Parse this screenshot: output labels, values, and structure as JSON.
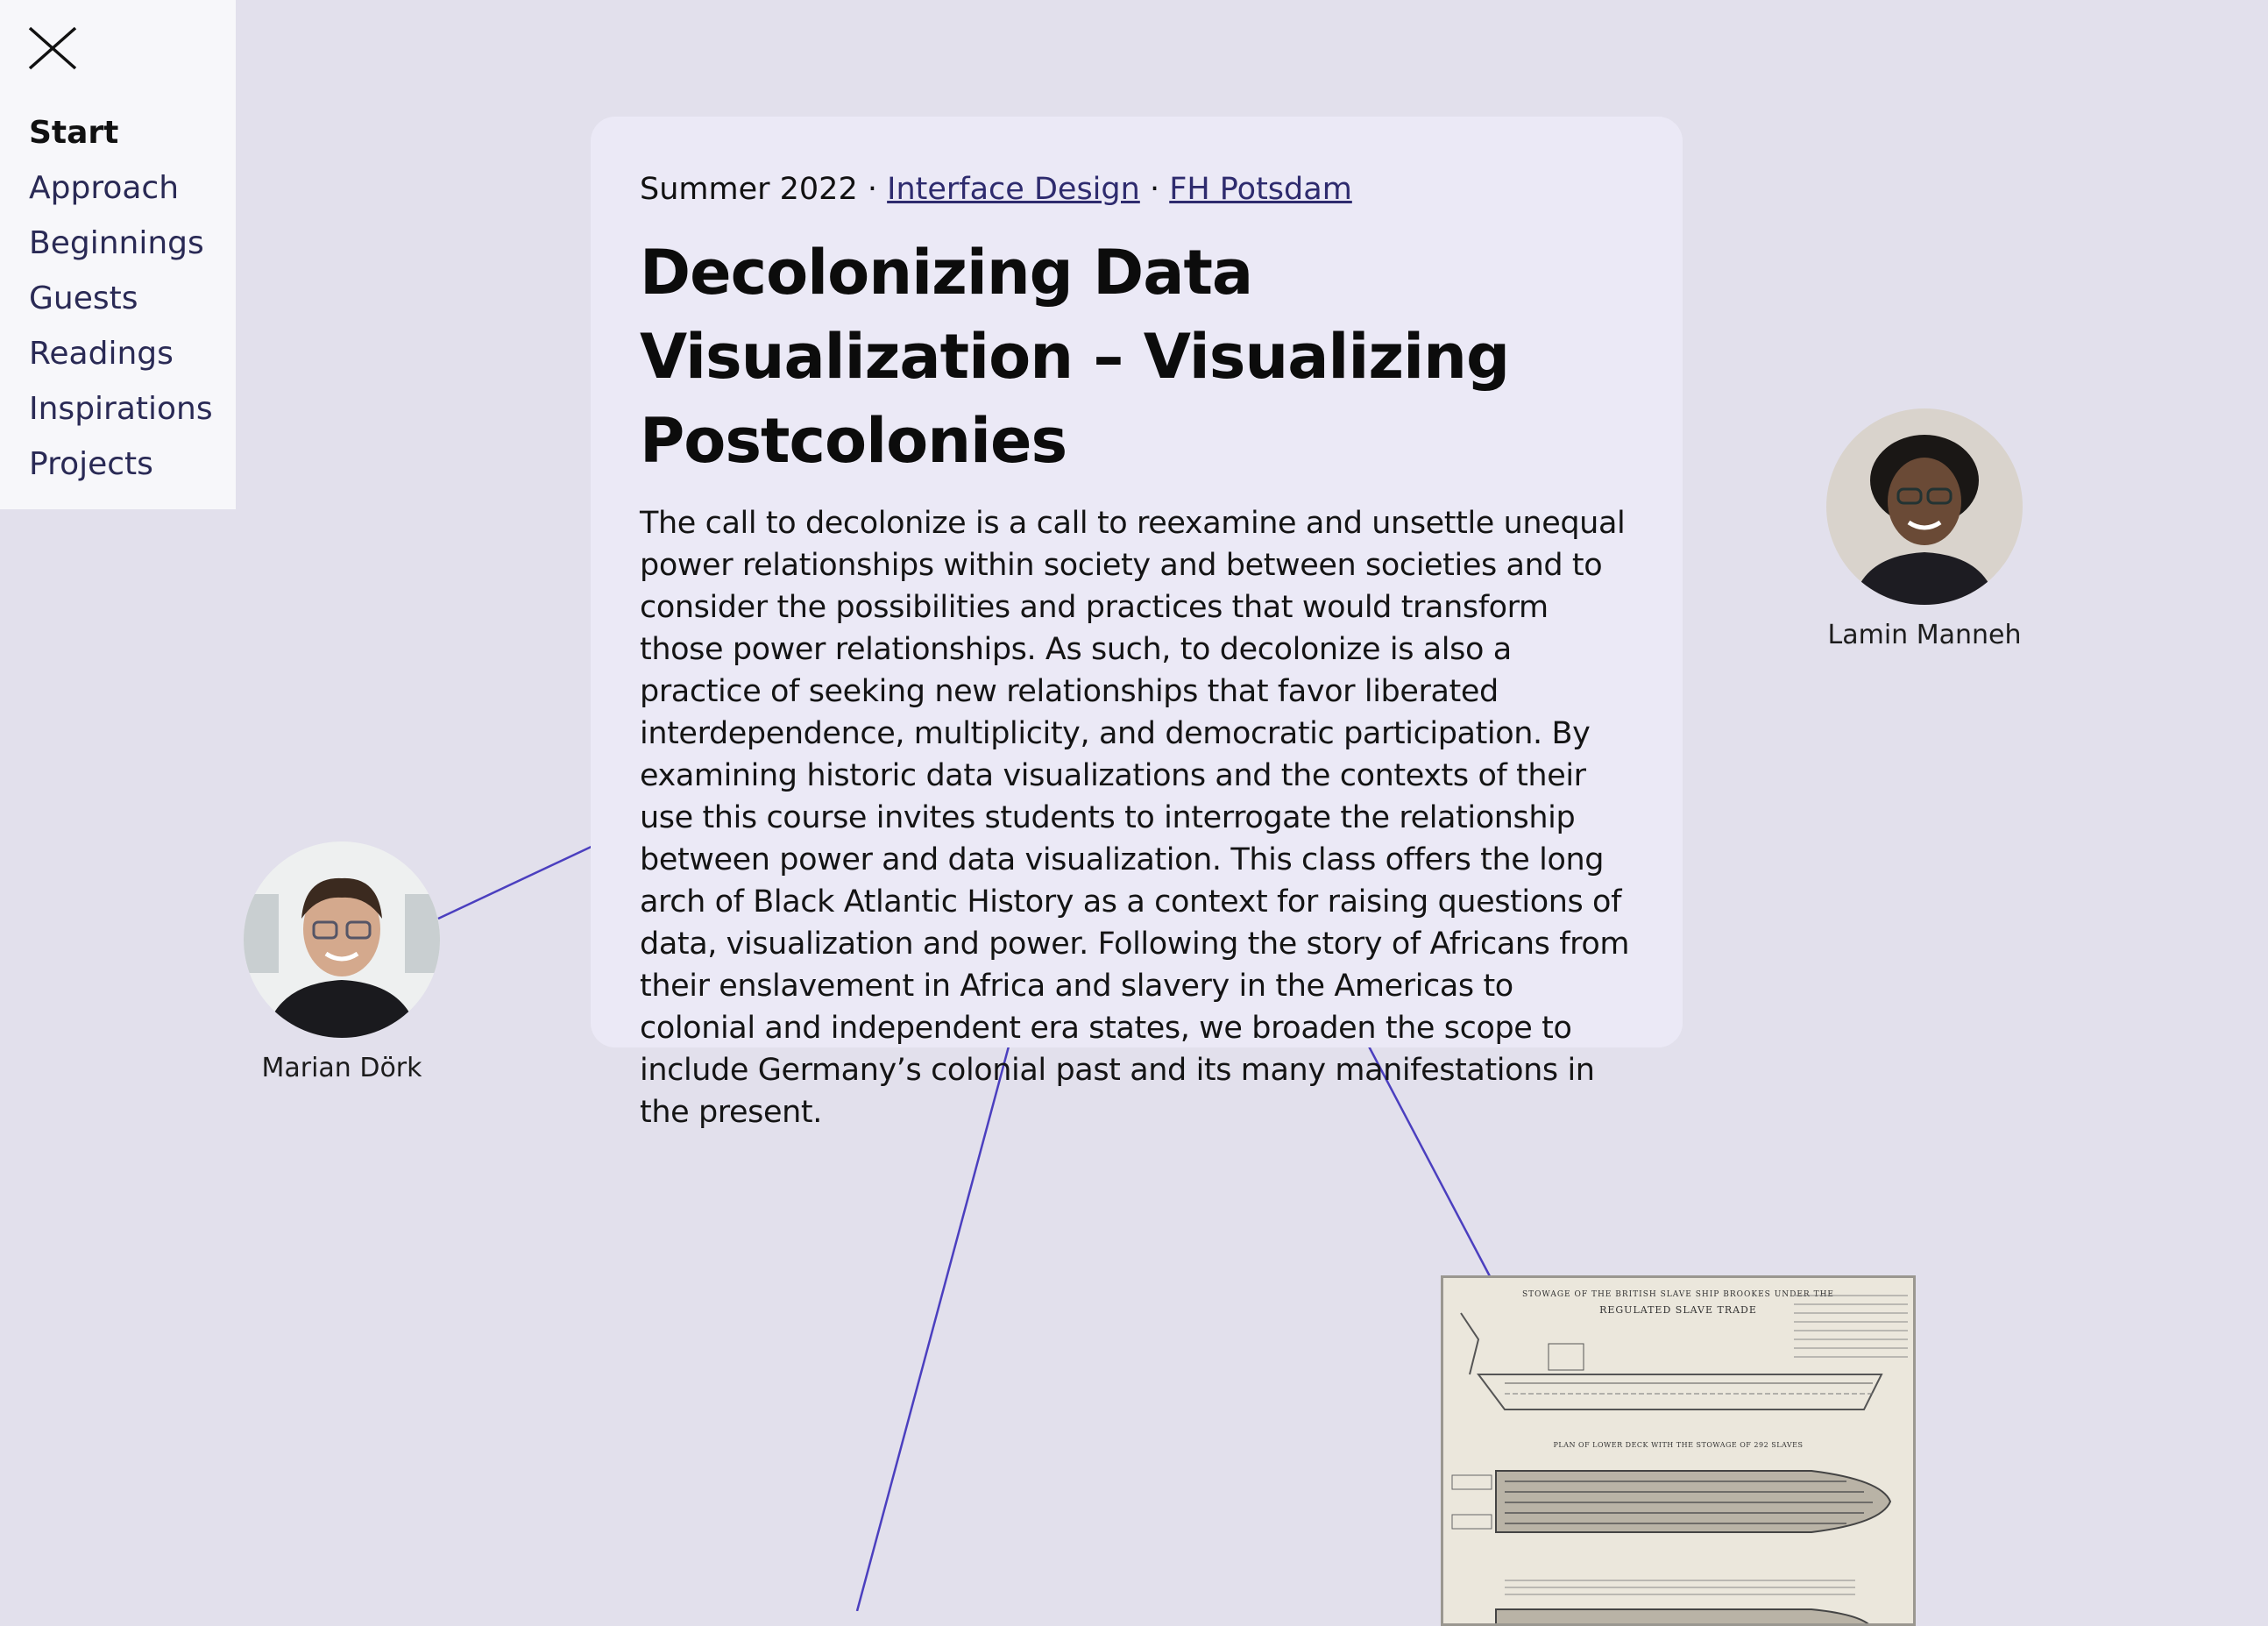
{
  "sidebar": {
    "close_icon": "close-icon",
    "items": [
      {
        "label": "Start",
        "active": true
      },
      {
        "label": "Approach"
      },
      {
        "label": "Beginnings"
      },
      {
        "label": "Guests"
      },
      {
        "label": "Readings"
      },
      {
        "label": "Inspirations"
      },
      {
        "label": "Projects"
      }
    ]
  },
  "intro": {
    "semester": "Summer 2022",
    "separator": "·",
    "course": "Interface Design",
    "school": "FH Potsdam",
    "title": "Decolonizing Data Visualization – Visualizing Postcolonies",
    "description": "The call to decolonize is a call to reexamine and unsettle unequal power relationships within society and between societies and to consider the possibilities and practices that would transform those power relationships. As such, to decolonize is also a practice of seeking new relationships that favor liberated interdependence, multiplicity, and democratic participation. By examining historic data visualizations and the contexts of their use this course invites students to interrogate the relationship between power and data visualization. This class offers the long arch of Black Atlantic History as a context for raising questions of data, visualization and power. Following the story of Africans from their enslavement in Africa and slavery in the Americas to colonial and independent era states, we broaden the scope to include Germany’s colonial past and its many manifestations in the present."
  },
  "people": {
    "lamin": {
      "name": "Lamin Manneh"
    },
    "marian": {
      "name": "Marian Dörk"
    }
  },
  "ship_image": {
    "heading": "STOWAGE OF THE BRITISH SLAVE SHIP BROOKES UNDER THE",
    "subheading": "REGULATED SLAVE TRADE",
    "caption": "PLAN OF LOWER DECK WITH THE STOWAGE OF 292 SLAVES"
  },
  "colors": {
    "background": "#e2e0ec",
    "card": "#ebe9f6",
    "link_line": "#4b3fbf",
    "sidebar": "#f7f7fa"
  }
}
